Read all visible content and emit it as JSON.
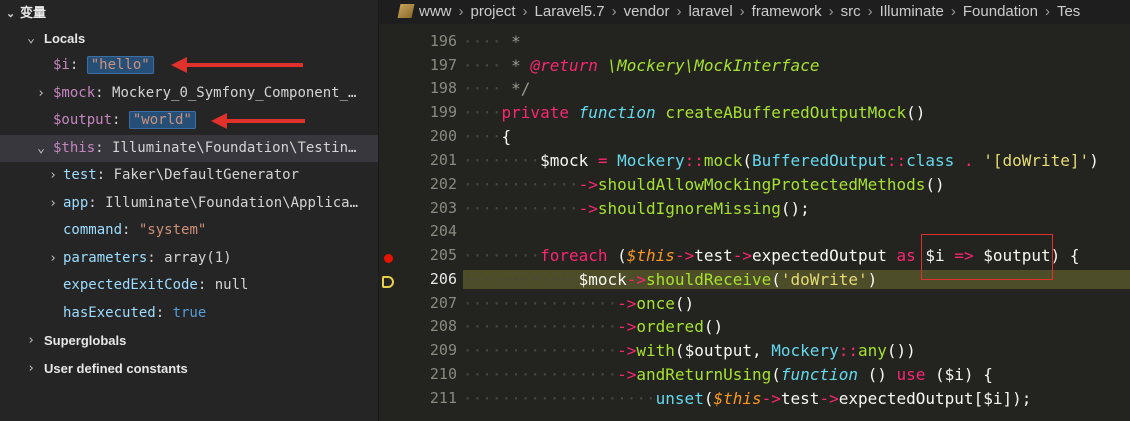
{
  "panel": {
    "title": "变量",
    "locals_label": "Locals",
    "vars": [
      {
        "name": "$i",
        "value": "\"hello\""
      },
      {
        "name": "$mock",
        "value": "Mockery_0_Symfony_Component_…"
      },
      {
        "name": "$output",
        "value": "\"world\""
      },
      {
        "name": "$this",
        "value": "Illuminate\\Foundation\\Testin…"
      }
    ],
    "this_children": [
      {
        "name": "test",
        "value": "Faker\\DefaultGenerator"
      },
      {
        "name": "app",
        "value": "Illuminate\\Foundation\\Applica…"
      },
      {
        "name": "command",
        "value": "\"system\""
      },
      {
        "name": "parameters",
        "value": "array(1)"
      },
      {
        "name": "expectedExitCode",
        "value": "null"
      },
      {
        "name": "hasExecuted",
        "value": "true"
      }
    ],
    "superglobals_label": "Superglobals",
    "user_constants_label": "User defined constants"
  },
  "breadcrumb": [
    "www",
    "project",
    "Laravel5.7",
    "vendor",
    "laravel",
    "framework",
    "src",
    "Illuminate",
    "Foundation",
    "Tes"
  ],
  "editor": {
    "line_numbers": [
      "196",
      "197",
      "198",
      "199",
      "200",
      "201",
      "202",
      "203",
      "204",
      "205",
      "206",
      "207",
      "208",
      "209",
      "210",
      "211"
    ],
    "code": {
      "l196": "*",
      "l197_tag": "@return",
      "l197_type": "\\Mockery\\MockInterface",
      "l198": "*/",
      "l199_kw1": "private",
      "l199_kw2": "function",
      "l199_fn": "createABufferedOutputMock",
      "l199_paren": "()",
      "l200": "{",
      "l201_var": "$mock",
      "l201_eq": " = ",
      "l201_cls": "Mockery",
      "l201_sep": "::",
      "l201_fn": "mock",
      "l201_open": "(",
      "l201_cls2": "BufferedOutput",
      "l201_kw": "class",
      "l201_dot": " . ",
      "l201_str": "'[doWrite]'",
      "l201_close": ")",
      "l202_arrow": "->",
      "l202_fn": "shouldAllowMockingProtectedMethods",
      "l202_end": "()",
      "l203_arrow": "->",
      "l203_fn": "shouldIgnoreMissing",
      "l203_end": "();",
      "l205_kw": "foreach",
      "l205_open": " (",
      "l205_this": "$this",
      "l205_arrow1": "->",
      "l205_prop1": "test",
      "l205_arrow2": "->",
      "l205_prop2": "expectedOutput",
      "l205_as": "as",
      "l205_i": "$i",
      "l205_fat": " => ",
      "l205_out": "$output",
      "l205_end": ") {",
      "l206_var": "$mock",
      "l206_arrow": "->",
      "l206_fn": "shouldReceive",
      "l206_open": "(",
      "l206_str": "'doWrite'",
      "l206_close": ")",
      "l207_arrow": "->",
      "l207_fn": "once",
      "l207_end": "()",
      "l208_arrow": "->",
      "l208_fn": "ordered",
      "l208_end": "()",
      "l209_arrow": "->",
      "l209_fn": "with",
      "l209_open": "(",
      "l209_out": "$output",
      "l209_comma": ", ",
      "l209_cls": "Mockery",
      "l209_sep": "::",
      "l209_fn2": "any",
      "l209_end": "())",
      "l210_arrow": "->",
      "l210_fn": "andReturnUsing",
      "l210_open": "(",
      "l210_kw": "function",
      "l210_paren": " () ",
      "l210_use": "use",
      "l210_open2": " (",
      "l210_i": "$i",
      "l210_end": ") {",
      "l211_fn": "unset",
      "l211_open": "(",
      "l211_this": "$this",
      "l211_arrow1": "->",
      "l211_prop1": "test",
      "l211_arrow2": "->",
      "l211_prop2": "expectedOutput",
      "l211_br": "[",
      "l211_i": "$i",
      "l211_end": "]);"
    }
  },
  "colors": {
    "breakpoint": "#e51400",
    "annotation_red": "#e0312a",
    "current_line": "#4d4d2a",
    "selection": "#37373d"
  }
}
